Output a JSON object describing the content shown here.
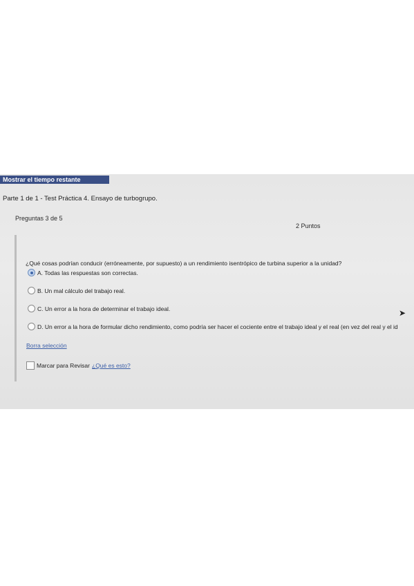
{
  "timer": {
    "label": "Mostrar el tiempo restante"
  },
  "header": {
    "part_title": "Parte 1 de 1 - Test Práctica 4. Ensayo de turbogrupo."
  },
  "question": {
    "count": "Preguntas 3 de 5",
    "points": "2 Puntos",
    "text": "¿Qué cosas podrían conducir (erróneamente, por supuesto) a un rendimiento isentrópico de turbina superior a la unidad?",
    "options": [
      {
        "label": "A. Todas las respuestas son correctas.",
        "selected": true
      },
      {
        "label": "B. Un mal cálculo del trabajo real.",
        "selected": false
      },
      {
        "label": "C. Un error a la hora de determinar el trabajo ideal.",
        "selected": false
      },
      {
        "label": "D. Un error a la hora de formular dicho rendimiento, como podría ser hacer el cociente entre el trabajo ideal y el real (en vez del real y el id",
        "selected": false
      }
    ],
    "clear_selection": "Borra selección",
    "mark_review": "Marcar para Revisar",
    "help_link": "¿Qué es esto?"
  },
  "colors": {
    "timer_bg": "#3a4f86",
    "link": "#3c5fa8"
  }
}
